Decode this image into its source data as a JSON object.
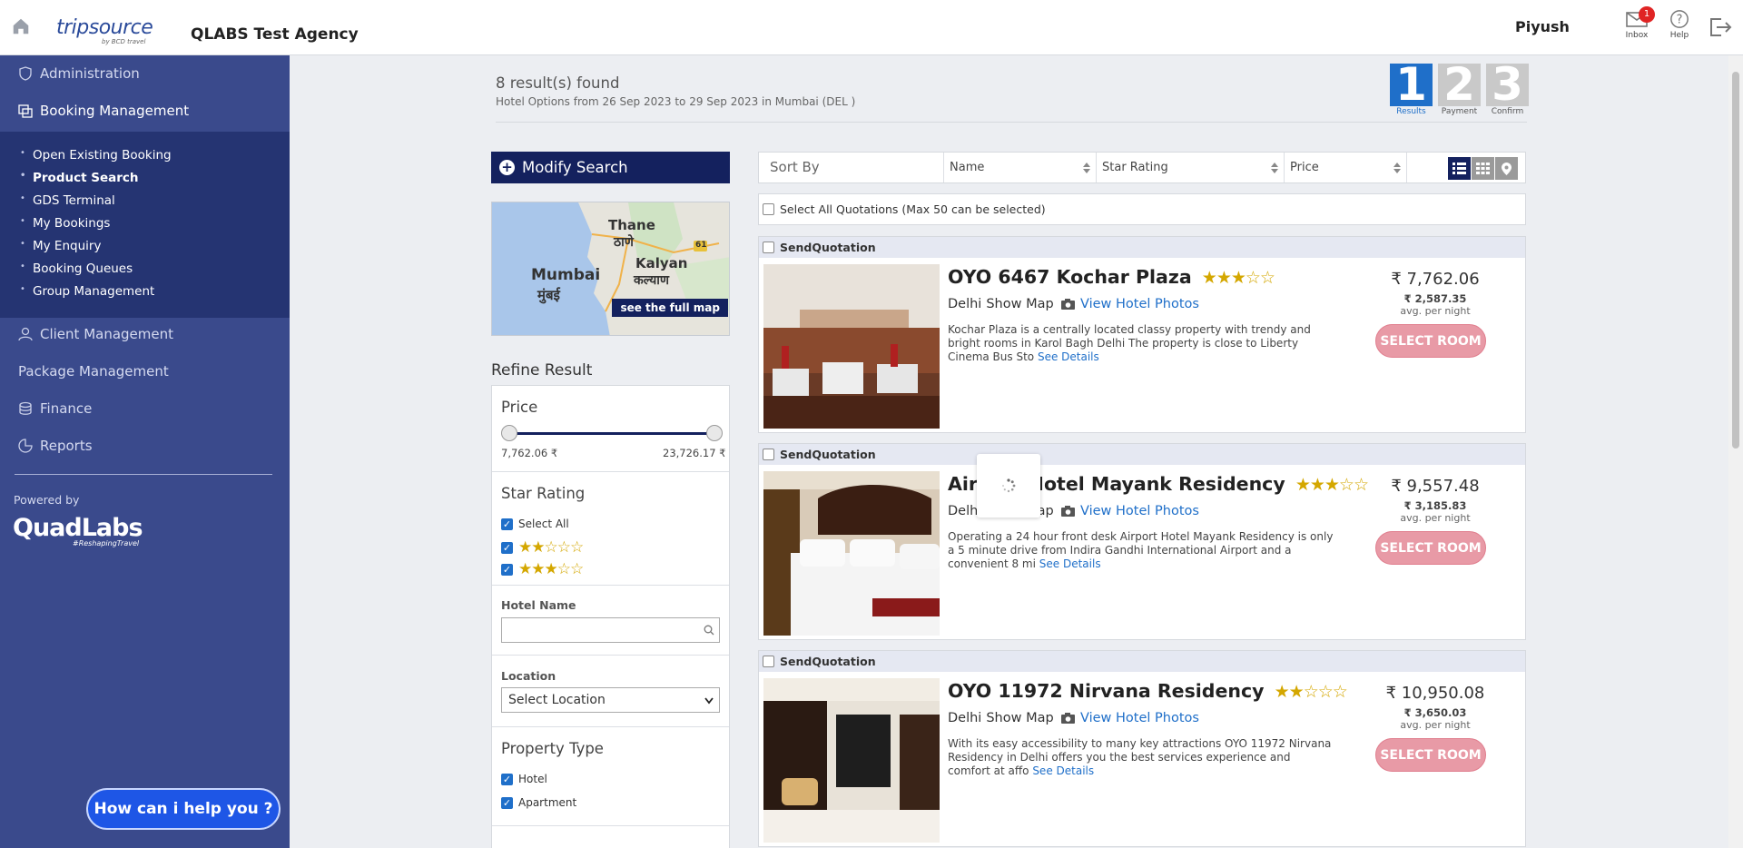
{
  "header": {
    "logo": "tripsource",
    "logo_sub": "by BCD travel",
    "agency": "QLABS Test Agency",
    "user": "Piyush",
    "inbox_label": "Inbox",
    "inbox_count": "1",
    "help_label": "Help"
  },
  "sidebar": {
    "items": [
      {
        "label": "Administration"
      },
      {
        "label": "Booking Management"
      },
      {
        "label": "Client Management"
      },
      {
        "label": "Package Management"
      },
      {
        "label": "Finance"
      },
      {
        "label": "Reports"
      }
    ],
    "submenu": [
      {
        "label": "Open Existing Booking"
      },
      {
        "label": "Product Search"
      },
      {
        "label": "GDS Terminal"
      },
      {
        "label": "My Bookings"
      },
      {
        "label": "My Enquiry"
      },
      {
        "label": "Booking Queues"
      },
      {
        "label": "Group Management"
      }
    ],
    "powered_by": "Powered by",
    "brand": "QuadLabs",
    "brand_tag": "#ReshapingTravel",
    "chat": "How can i help you ?"
  },
  "results": {
    "count": "8 result(s) found",
    "subtitle": "Hotel Options from  26 Sep 2023 to 29 Sep 2023 in Mumbai (DEL )"
  },
  "steps": [
    {
      "num": "1",
      "label": "Results"
    },
    {
      "num": "2",
      "label": "Payment"
    },
    {
      "num": "3",
      "label": "Confirm"
    }
  ],
  "filters": {
    "modify_search": "Modify Search",
    "map_button": "see the full map",
    "map_labels": {
      "thane": "Thane",
      "thane_local": "ठाणे",
      "kalyan": "Kalyan",
      "kalyan_local": "कल्याण",
      "mumbai": "Mumbai",
      "mumbai_local": "मुंबई",
      "road": "61"
    },
    "refine_title": "Refine Result",
    "price_title": "Price",
    "price_min": "7,762.06 ₹",
    "price_max": "23,726.17 ₹",
    "star_title": "Star Rating",
    "select_all": "Select All",
    "star_options": [
      {
        "stars": "★★☆☆☆"
      },
      {
        "stars": "★★★☆☆"
      }
    ],
    "hotel_name_title": "Hotel Name",
    "location_title": "Location",
    "location_value": "Select Location",
    "property_title": "Property Type",
    "property_options": [
      {
        "label": "Hotel"
      },
      {
        "label": "Apartment"
      }
    ]
  },
  "sort": {
    "label": "Sort By",
    "name": "Name",
    "star": "Star Rating",
    "price": "Price",
    "select_all_quotations": "Select All Quotations (Max 50 can be selected)"
  },
  "hotels": [
    {
      "quote_label": "SendQuotation",
      "name": "OYO 6467 Kochar Plaza",
      "stars": "★★★☆☆",
      "city": "Delhi",
      "map_link": "Show Map",
      "photos_link": "View Hotel Photos",
      "desc": "Kochar Plaza is a centrally located classy property with trendy and bright rooms in Karol Bagh Delhi The property is close to Liberty Cinema Bus Sto",
      "see_details": "See Details",
      "price": "₹ 7,762.06",
      "per_night": "₹ 2,587.35",
      "avg": "avg. per night",
      "select": "SELECT ROOM"
    },
    {
      "quote_label": "SendQuotation",
      "name": "Airport Hotel Mayank Residency",
      "stars": "★★★☆☆",
      "city": "Delhi",
      "map_link": "Show Map",
      "photos_link": "View Hotel Photos",
      "desc": "Operating a 24 hour front desk Airport Hotel Mayank Residency is only a 5 minute drive from Indira Gandhi International Airport and a convenient 8 mi",
      "see_details": "See Details",
      "price": "₹ 9,557.48",
      "per_night": "₹ 3,185.83",
      "avg": "avg. per night",
      "select": "SELECT ROOM"
    },
    {
      "quote_label": "SendQuotation",
      "name": "OYO 11972 Nirvana Residency",
      "stars": "★★☆☆☆",
      "city": "Delhi",
      "map_link": "Show Map",
      "photos_link": "View Hotel Photos",
      "desc": "With its easy accessibility to many key attractions OYO 11972 Nirvana Residency in Delhi offers you the best services experience and comfort at affo",
      "see_details": "See Details",
      "price": "₹ 10,950.08",
      "per_night": "₹ 3,650.03",
      "avg": "avg. per night",
      "select": "SELECT ROOM"
    }
  ],
  "colors": {
    "sidebar": "#3a4a8c",
    "submenu": "#253472",
    "navy": "#14215e",
    "accent": "#1f6fc9",
    "select_btn": "#e89aa6",
    "star": "#d4a700"
  },
  "icons": [
    "home-icon",
    "inbox-icon",
    "help-icon",
    "logout-icon",
    "shield-icon",
    "bookings-icon",
    "client-icon",
    "finance-icon",
    "reports-icon",
    "camera-icon",
    "search-icon",
    "list-view-icon",
    "grid-view-icon",
    "map-view-icon",
    "spinner-icon"
  ]
}
